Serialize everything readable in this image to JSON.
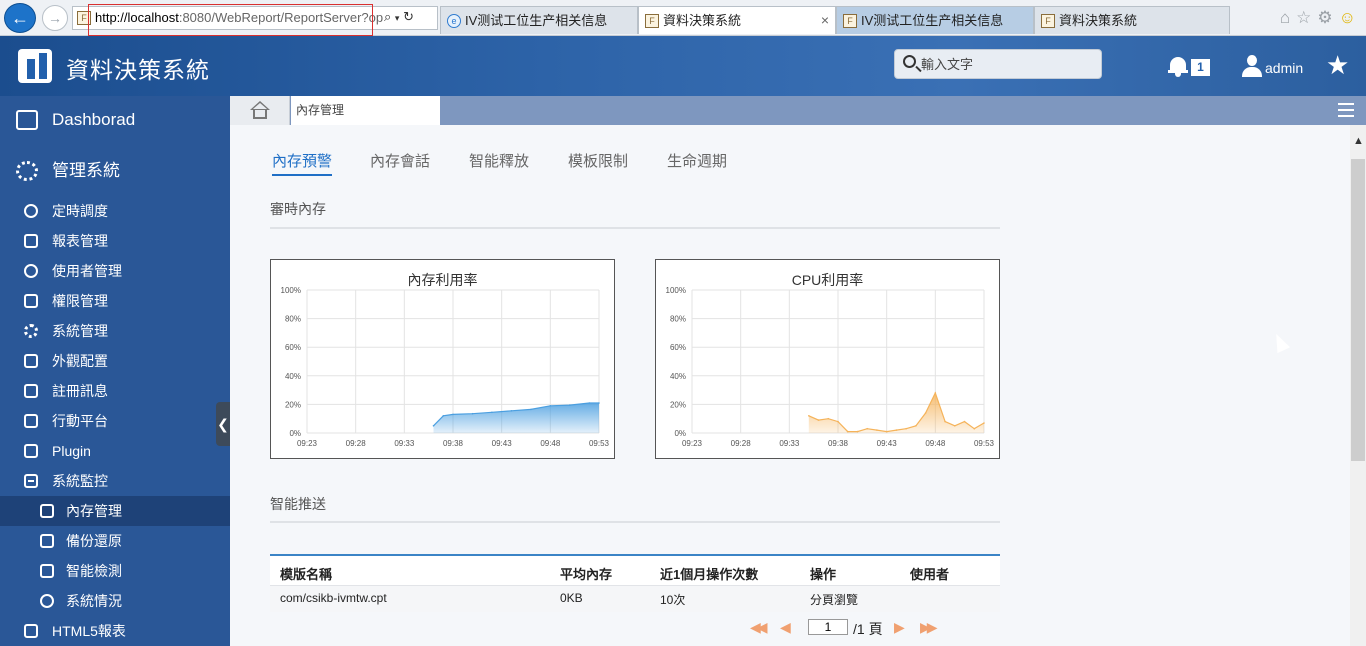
{
  "browser": {
    "url_host": "http://localhost",
    "url_rest": ":8080/WebReport/ReportServer?op",
    "tabs": [
      {
        "label": "IV测试工位生产相关信息",
        "state": "normal"
      },
      {
        "label": "資料決策系統",
        "state": "active"
      },
      {
        "label": "IV测试工位生产相关信息",
        "state": "hover"
      },
      {
        "label": "資料決策系統",
        "state": "normal"
      }
    ],
    "close_glyph": "×"
  },
  "header": {
    "title": "資料決策系統",
    "search_placeholder": "輸入文字",
    "notification_count": "1",
    "username": "admin"
  },
  "sidebar": {
    "top_items": [
      {
        "label": "Dashborad",
        "icon": "dashboard-icon"
      },
      {
        "label": "管理系統",
        "icon": "gear-icon"
      }
    ],
    "items": [
      {
        "label": "定時調度",
        "icon": "clock-icon"
      },
      {
        "label": "報表管理",
        "icon": "report-icon"
      },
      {
        "label": "使用者管理",
        "icon": "user-icon"
      },
      {
        "label": "權限管理",
        "icon": "lock-icon"
      },
      {
        "label": "系統管理",
        "icon": "gear-icon"
      },
      {
        "label": "外觀配置",
        "icon": "brush-icon"
      },
      {
        "label": "註冊訊息",
        "icon": "register-icon"
      },
      {
        "label": "行動平台",
        "icon": "mobile-icon"
      },
      {
        "label": "Plugin",
        "icon": "plugin-icon"
      },
      {
        "label": "系統監控",
        "icon": "minus-square-icon"
      }
    ],
    "sub_items": [
      {
        "label": "內存管理",
        "icon": "memory-icon",
        "active": true
      },
      {
        "label": "備份還原",
        "icon": "backup-icon"
      },
      {
        "label": "智能檢測",
        "icon": "monitor-icon"
      },
      {
        "label": "系統情況",
        "icon": "speedometer-icon"
      }
    ],
    "last_item": {
      "label": "HTML5報表",
      "icon": "html5-icon"
    }
  },
  "content_tab": {
    "label": "內存管理"
  },
  "subtabs": [
    "內存預警",
    "內存會話",
    "智能釋放",
    "模板限制",
    "生命週期"
  ],
  "sections": {
    "realtime": "審時內存",
    "push": "智能推送"
  },
  "chart_data": [
    {
      "type": "area",
      "title": "內存利用率",
      "ylim": [
        0,
        100
      ],
      "y_ticks": [
        "0%",
        "20%",
        "40%",
        "60%",
        "80%",
        "100%"
      ],
      "x_ticks": [
        "09:23",
        "09:28",
        "09:33",
        "09:38",
        "09:43",
        "09:48",
        "09:53"
      ],
      "grid": true,
      "color": "#4b9fe0",
      "x": [
        "09:36",
        "09:37",
        "09:38",
        "09:40",
        "09:42",
        "09:44",
        "09:46",
        "09:48",
        "09:50",
        "09:52",
        "09:53"
      ],
      "values": [
        5,
        12,
        13,
        13.5,
        14.5,
        15.5,
        16.5,
        19,
        19.5,
        21,
        21
      ]
    },
    {
      "type": "area",
      "title": "CPU利用率",
      "ylim": [
        0,
        100
      ],
      "y_ticks": [
        "0%",
        "20%",
        "40%",
        "60%",
        "80%",
        "100%"
      ],
      "x_ticks": [
        "09:23",
        "09:28",
        "09:33",
        "09:38",
        "09:43",
        "09:48",
        "09:53"
      ],
      "grid": true,
      "color": "#f5b35a",
      "x": [
        "09:35",
        "09:36",
        "09:37",
        "09:38",
        "09:39",
        "09:40",
        "09:41",
        "09:42",
        "09:43",
        "09:44",
        "09:45",
        "09:46",
        "09:47",
        "09:48",
        "09:49",
        "09:50",
        "09:51",
        "09:52",
        "09:53"
      ],
      "values": [
        12,
        9,
        10,
        8,
        1,
        1,
        3,
        2,
        1,
        2,
        3,
        5,
        14,
        28,
        8,
        5,
        8,
        3,
        7
      ]
    }
  ],
  "table": {
    "headers": [
      "模版名稱",
      "平均內存",
      "近1個月操作次數",
      "操作",
      "使用者"
    ],
    "rows": [
      [
        "com/csikb-ivmtw.cpt",
        "0KB",
        "10次",
        "分頁瀏覽",
        ""
      ]
    ]
  },
  "pager": {
    "current": "1",
    "total_label": "/1 頁"
  }
}
